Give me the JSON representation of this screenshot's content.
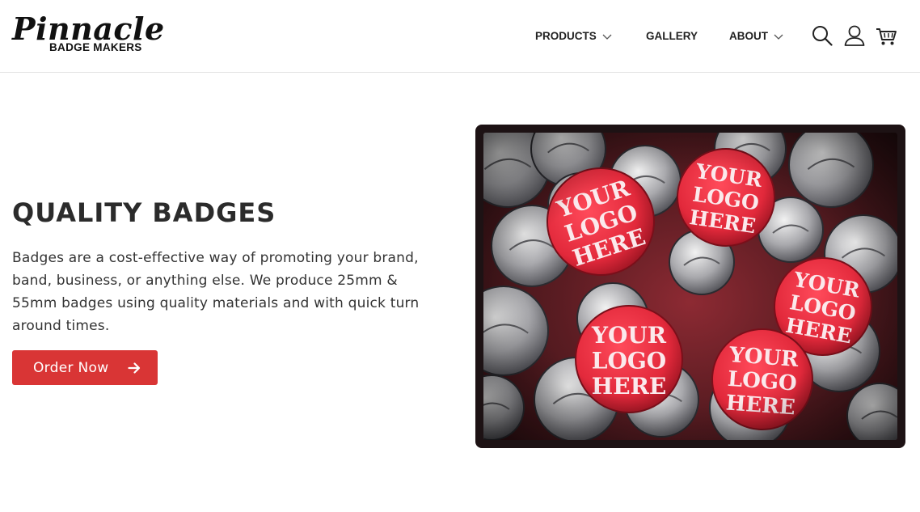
{
  "brand": {
    "name": "Pinnacle",
    "tagline": "BADGE MAKERS"
  },
  "nav": {
    "products_label": "PRODUCTS",
    "gallery_label": "GALLERY",
    "about_label": "ABOUT"
  },
  "icons": {
    "search": "search-icon",
    "account": "user-icon",
    "cart": "cart-icon",
    "dropdown": "chevron-down-icon",
    "arrow": "arrow-right-icon"
  },
  "hero": {
    "title": "QUALITY BADGES",
    "description": "Badges are a cost-effective way of promoting your brand, band, business, or anything else. We produce 25mm & 55mm badges using quality materials and with quick turn around times.",
    "cta_label": "Order Now"
  },
  "photo": {
    "badge_text": [
      "YOUR",
      "LOGO",
      "HERE"
    ]
  },
  "colors": {
    "accent": "#d93535",
    "badge_red": "#e2293b",
    "text_dark": "#2b2b2b"
  }
}
